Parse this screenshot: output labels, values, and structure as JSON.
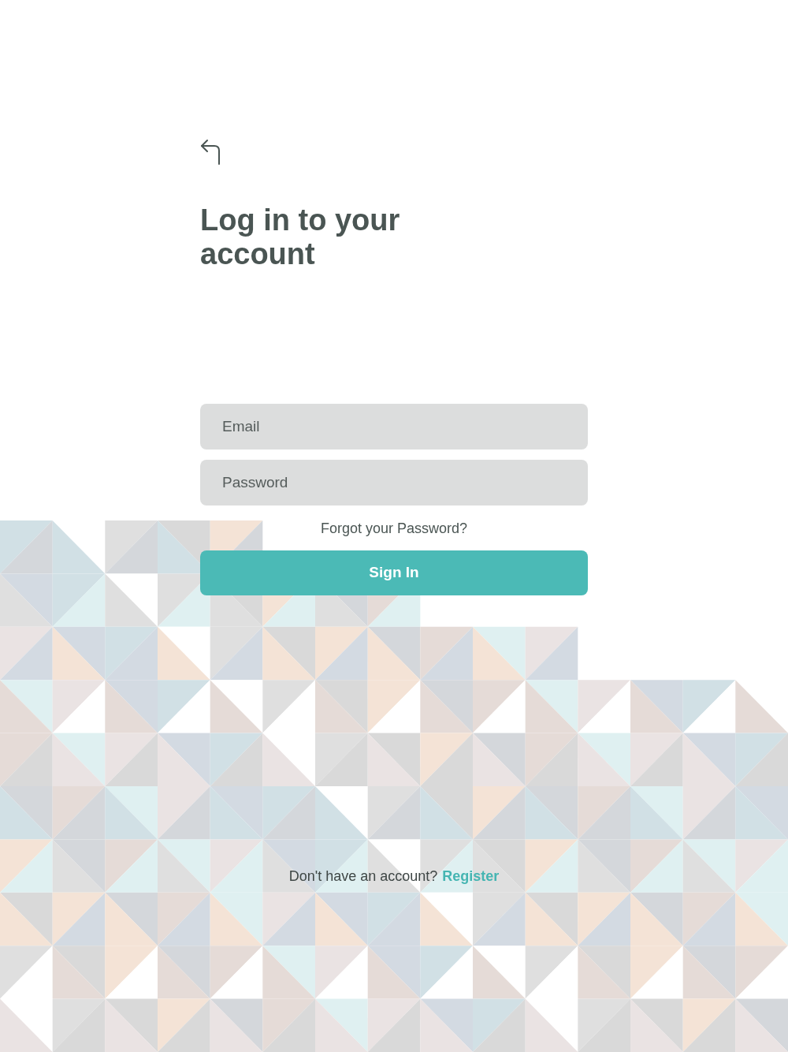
{
  "title": "Log in to your account",
  "email_field": {
    "placeholder": "Email"
  },
  "password_field": {
    "placeholder": "Password"
  },
  "forgot_link": "Forgot your Password?",
  "submit_button": "Sign In",
  "register": {
    "prompt": "Don't have an account?",
    "link": "Register"
  }
}
